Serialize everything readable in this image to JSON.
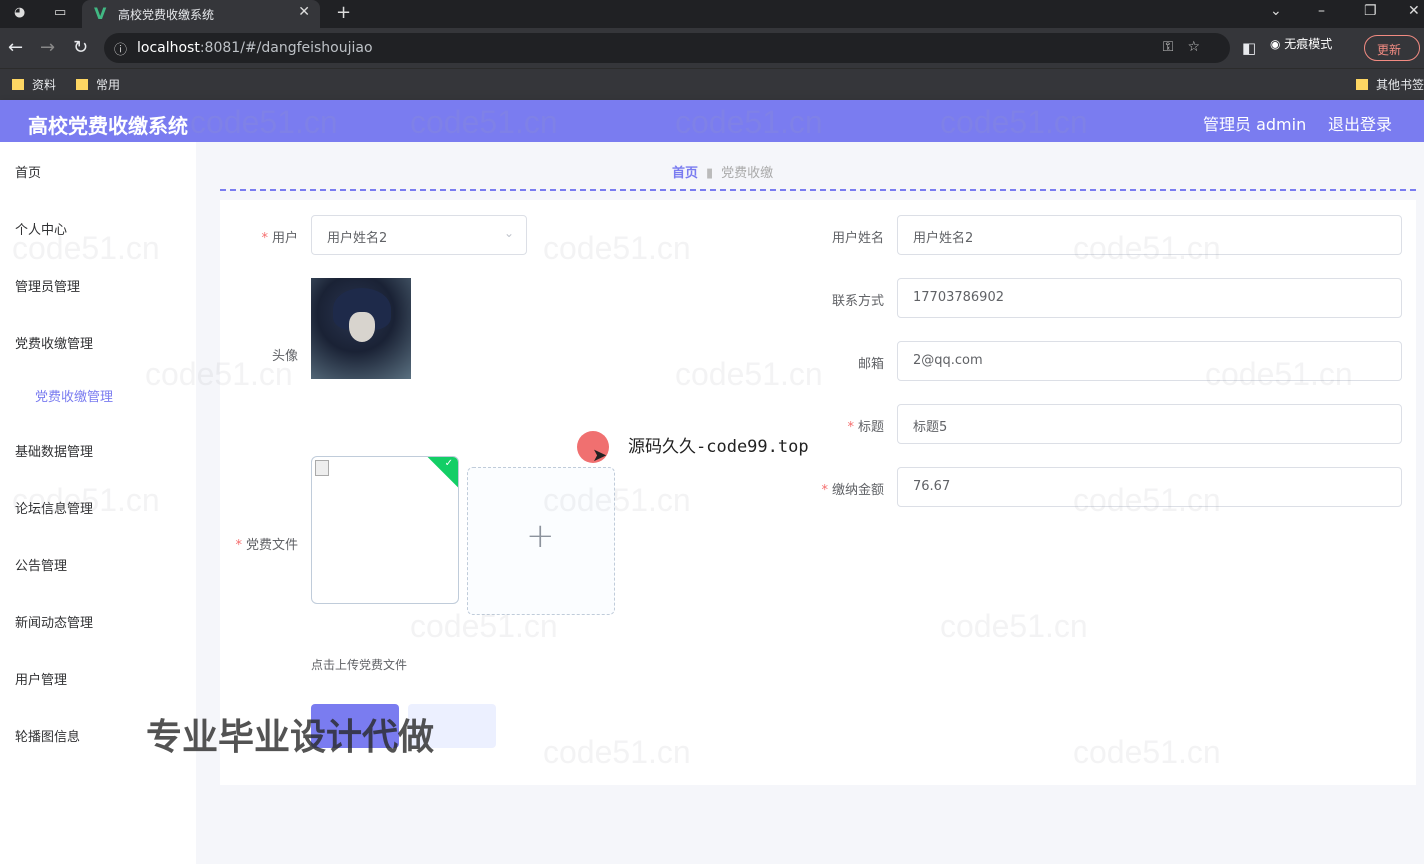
{
  "browser": {
    "tab_title": "高校党费收缴系统",
    "tab_logo": "V",
    "url_host": "localhost",
    "url_rest": ":8081/#/dangfeishoujiao",
    "incognito_label": "无痕模式",
    "update_label": "更新",
    "bookmarks": [
      "资料",
      "常用",
      "其他书签"
    ]
  },
  "header": {
    "title": "高校党费收缴系统",
    "user_label": "管理员 admin",
    "logout_label": "退出登录"
  },
  "sidebar": {
    "items": [
      {
        "label": "首页"
      },
      {
        "label": "个人中心"
      },
      {
        "label": "管理员管理"
      },
      {
        "label": "党费收缴管理"
      },
      {
        "label": "党费收缴管理"
      },
      {
        "label": "基础数据管理"
      },
      {
        "label": "论坛信息管理"
      },
      {
        "label": "公告管理"
      },
      {
        "label": "新闻动态管理"
      },
      {
        "label": "用户管理"
      },
      {
        "label": "轮播图信息"
      }
    ]
  },
  "breadcrumb": {
    "home": "首页",
    "current": "党费收缴"
  },
  "form": {
    "user_label": "用户",
    "user_value": "用户姓名2",
    "avatar_label": "头像",
    "file_label": "党费文件",
    "upload_tip": "点击上传党费文件",
    "name_label": "用户姓名",
    "name_value": "用户姓名2",
    "phone_label": "联系方式",
    "phone_value": "17703786902",
    "email_label": "邮箱",
    "email_value": "2@qq.com",
    "title_label": "标题",
    "title_value": "标题5",
    "amount_label": "缴纳金额",
    "amount_value": "76.67"
  },
  "overlay": {
    "big_text": "专业毕业设计代做",
    "source_text": "源码久久-code99.top",
    "watermark": "code51.cn"
  },
  "colors": {
    "accent": "#7a7cf0",
    "required": "#f56c6c",
    "success": "#13ce66"
  }
}
